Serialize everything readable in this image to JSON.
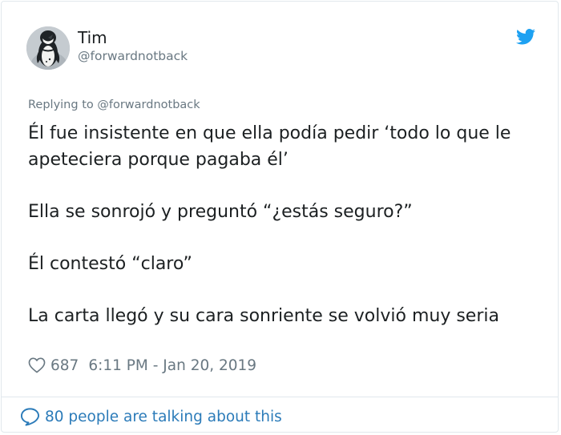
{
  "author": {
    "display_name": "Tim",
    "handle": "@forwardnotback"
  },
  "reply_context": "Replying to @forwardnotback",
  "tweet": {
    "paragraphs": [
      "Él fue insistente en que ella podía pedir ‘todo lo que le apeteciera porque pagaba él’",
      "Ella se sonrojó y preguntó “¿estás seguro?”",
      "Él contestó “claro”",
      "La carta llegó y su cara sonriente se volvió muy seria"
    ]
  },
  "meta": {
    "likes": "687",
    "timestamp": "6:11 PM - Jan 20, 2019"
  },
  "footer": {
    "talking_text": "80 people are talking about this"
  },
  "icons": {
    "brand": "twitter-bird-icon",
    "like": "heart-icon",
    "conversation": "speech-bubble-icon"
  },
  "colors": {
    "brand_blue": "#1da1f2",
    "link_blue": "#2b7bb9",
    "secondary_text": "#697882",
    "border": "#e1e8ed"
  }
}
